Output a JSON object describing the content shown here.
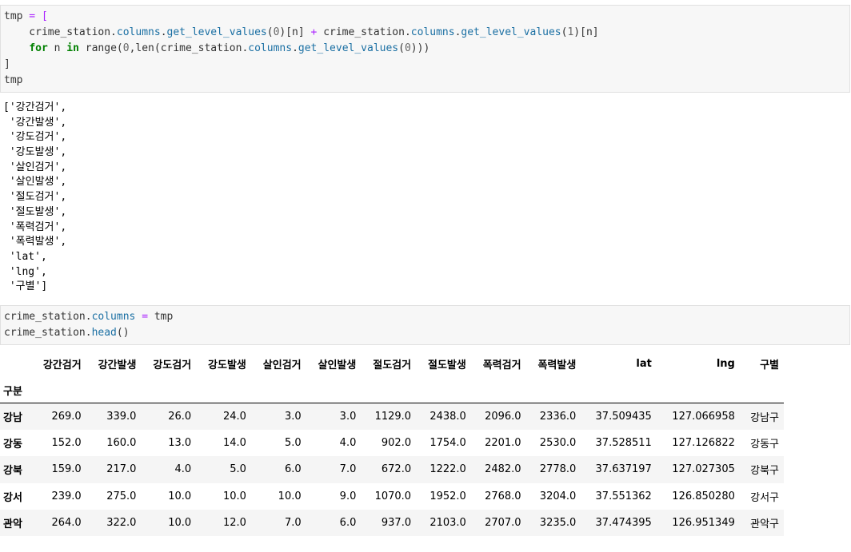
{
  "cell1": {
    "lines": [
      [
        "tmp",
        " = ["
      ],
      [
        "    crime_station.",
        "columns",
        ".",
        "get_level_values",
        "(",
        "0",
        ")[n] ",
        "+",
        " crime_station.",
        "columns",
        ".",
        "get_level_values",
        "(",
        "1",
        ")[n]"
      ],
      [
        "    ",
        "for",
        " n ",
        "in",
        " range(",
        "0",
        ",len(crime_station.",
        "columns",
        ".",
        "get_level_values",
        "(",
        "0",
        ")))"
      ],
      [
        "]"
      ],
      [
        "tmp"
      ]
    ]
  },
  "output1": {
    "lines": [
      "['강간검거',",
      " '강간발생',",
      " '강도검거',",
      " '강도발생',",
      " '살인검거',",
      " '살인발생',",
      " '절도검거',",
      " '절도발생',",
      " '폭력검거',",
      " '폭력발생',",
      " 'lat',",
      " 'lng',",
      " '구별']"
    ]
  },
  "cell2": {
    "line1_prefix": "crime_station.",
    "line1_attr": "columns",
    "line1_eq": " = ",
    "line1_rhs": "tmp",
    "line2_prefix": "crime_station.",
    "line2_attr": "head",
    "line2_suffix": "()"
  },
  "dataframe": {
    "columns": [
      "강간검거",
      "강간발생",
      "강도검거",
      "강도발생",
      "살인검거",
      "살인발생",
      "절도검거",
      "절도발생",
      "폭력검거",
      "폭력발생",
      "lat",
      "lng",
      "구별"
    ],
    "index_name": "구분",
    "rows": [
      {
        "index": "강남",
        "values": [
          "269.0",
          "339.0",
          "26.0",
          "24.0",
          "3.0",
          "3.0",
          "1129.0",
          "2438.0",
          "2096.0",
          "2336.0",
          "37.509435",
          "127.066958",
          "강남구"
        ]
      },
      {
        "index": "강동",
        "values": [
          "152.0",
          "160.0",
          "13.0",
          "14.0",
          "5.0",
          "4.0",
          "902.0",
          "1754.0",
          "2201.0",
          "2530.0",
          "37.528511",
          "127.126822",
          "강동구"
        ]
      },
      {
        "index": "강북",
        "values": [
          "159.0",
          "217.0",
          "4.0",
          "5.0",
          "6.0",
          "7.0",
          "672.0",
          "1222.0",
          "2482.0",
          "2778.0",
          "37.637197",
          "127.027305",
          "강북구"
        ]
      },
      {
        "index": "강서",
        "values": [
          "239.0",
          "275.0",
          "10.0",
          "10.0",
          "10.0",
          "9.0",
          "1070.0",
          "1952.0",
          "2768.0",
          "3204.0",
          "37.551362",
          "126.850280",
          "강서구"
        ]
      },
      {
        "index": "관악",
        "values": [
          "264.0",
          "322.0",
          "10.0",
          "12.0",
          "7.0",
          "6.0",
          "937.0",
          "2103.0",
          "2707.0",
          "3235.0",
          "37.474395",
          "126.951349",
          "관악구"
        ]
      }
    ]
  }
}
